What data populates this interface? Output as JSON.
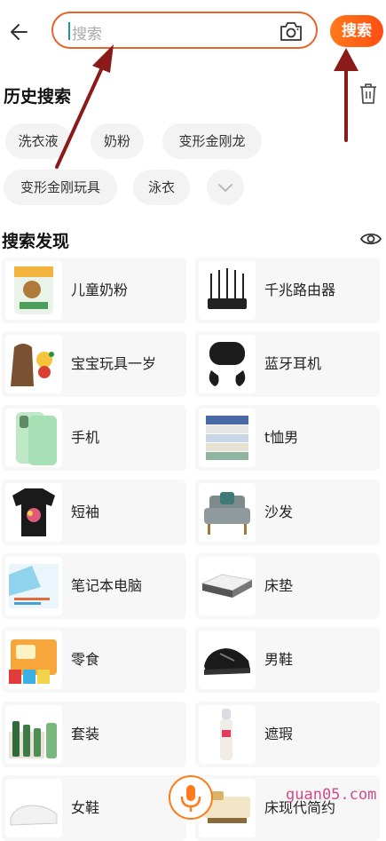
{
  "search": {
    "placeholder": "搜索",
    "button_label": "搜索"
  },
  "history": {
    "title": "历史搜索",
    "chips": [
      "洗衣液",
      "奶粉",
      "变形金刚龙",
      "变形金刚玩具",
      "泳衣"
    ]
  },
  "discover": {
    "title": "搜索发现",
    "items": [
      {
        "label": "儿童奶粉"
      },
      {
        "label": "千兆路由器"
      },
      {
        "label": "宝宝玩具一岁"
      },
      {
        "label": "蓝牙耳机"
      },
      {
        "label": "手机"
      },
      {
        "label": "t恤男"
      },
      {
        "label": "短袖"
      },
      {
        "label": "沙发"
      },
      {
        "label": "笔记本电脑"
      },
      {
        "label": "床垫"
      },
      {
        "label": "零食"
      },
      {
        "label": "男鞋"
      },
      {
        "label": "套装"
      },
      {
        "label": "遮瑕"
      },
      {
        "label": "女鞋"
      },
      {
        "label": "床现代简约"
      }
    ]
  },
  "watermark": "guan05.com",
  "colors": {
    "accent": "#ff5a14",
    "border": "#e8642a",
    "annotation_arrow": "#8b1a1a"
  },
  "icons": [
    "back-arrow-icon",
    "camera-icon",
    "trash-icon",
    "eye-icon",
    "chevron-down-icon",
    "microphone-icon"
  ]
}
